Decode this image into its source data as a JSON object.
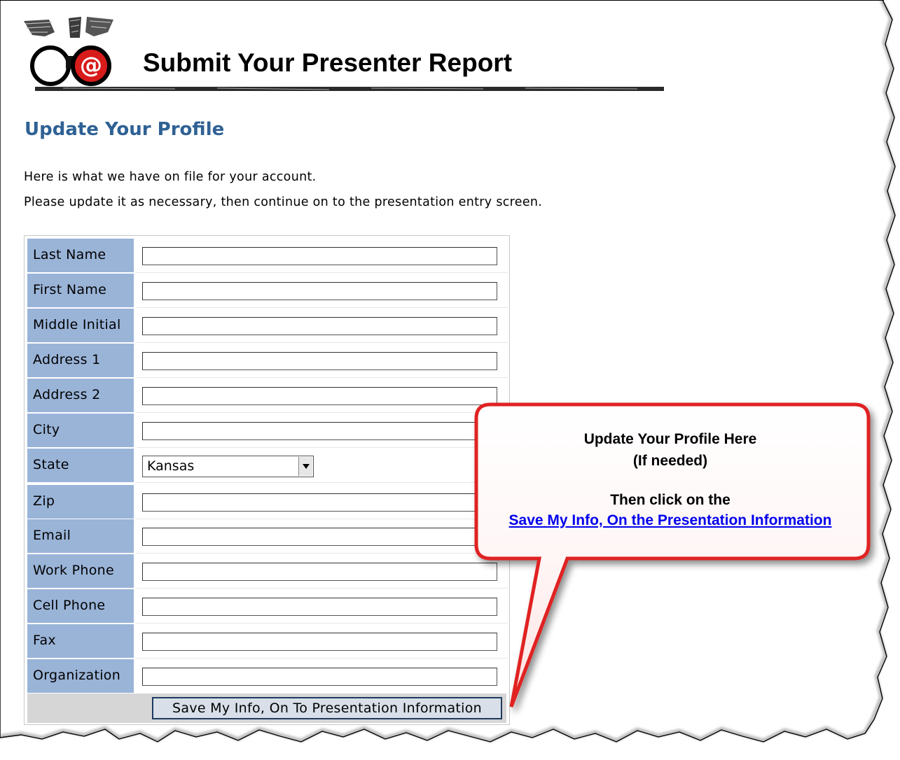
{
  "header": {
    "title": "Submit Your Presenter Report"
  },
  "page": {
    "title": "Update Your Profile",
    "intro_line_1": "Here is what we have on file for your account.",
    "intro_line_2": "Please update it as necessary, then continue on to the presentation entry screen."
  },
  "form": {
    "fields": [
      {
        "label": "Last Name",
        "value": ""
      },
      {
        "label": "First Name",
        "value": ""
      },
      {
        "label": "Middle Initial",
        "value": ""
      },
      {
        "label": "Address 1",
        "value": ""
      },
      {
        "label": "Address 2",
        "value": ""
      },
      {
        "label": "City",
        "value": ""
      },
      {
        "label": "State",
        "value": "Kansas"
      },
      {
        "label": "Zip",
        "value": ""
      },
      {
        "label": "Email",
        "value": ""
      },
      {
        "label": "Work Phone",
        "value": ""
      },
      {
        "label": "Cell Phone",
        "value": ""
      },
      {
        "label": "Fax",
        "value": ""
      },
      {
        "label": "Organization",
        "value": ""
      }
    ],
    "save_label": "Save My Info, On To Presentation Information"
  },
  "callout": {
    "line_1": "Update Your Profile Here",
    "line_2": "(If needed)",
    "line_3": "Then click on the",
    "link_text": "Save My Info, On the Presentation Information"
  },
  "colors": {
    "page_title": "#2f6194",
    "label_background": "#9ab4d8",
    "callout_border": "#e02020"
  }
}
